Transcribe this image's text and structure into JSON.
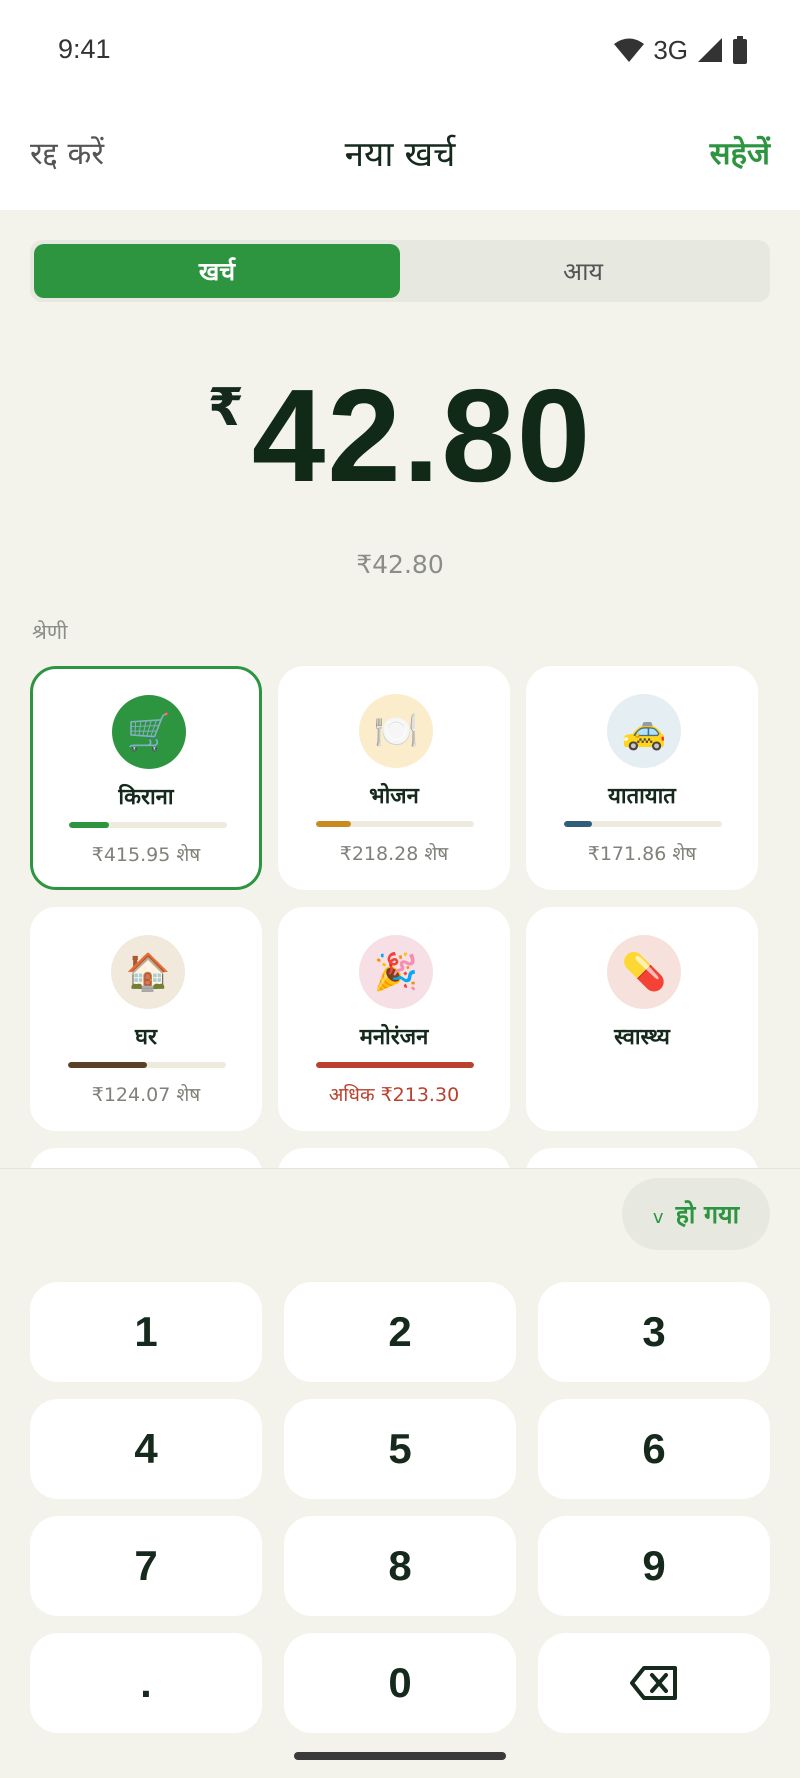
{
  "status_bar": {
    "time": "9:41",
    "network": "3G",
    "icons": [
      "wifi-icon",
      "cellular-signal-icon",
      "battery-icon"
    ]
  },
  "header": {
    "cancel_label": "रद्द करें",
    "title": "नया खर्च",
    "save_label": "सहेजें"
  },
  "type_toggle": {
    "expense_label": "खर्च",
    "income_label": "आय",
    "selected": "खर्च"
  },
  "amount": {
    "currency_symbol": "₹",
    "value": "42.80",
    "formatted": "₹42.80"
  },
  "category_section": {
    "label": "श्रेणी",
    "categories": [
      {
        "name": "किराना",
        "icon": "shopping-cart-icon",
        "glyph": "🛒",
        "remaining": "₹415.95 शेष",
        "progress": 0.25,
        "bar_color": "#2d9440",
        "icon_bg": "#2d9440",
        "selected": true
      },
      {
        "name": "भोजन",
        "icon": "plate-cutlery-icon",
        "glyph": "🍽️",
        "remaining": "₹218.28 शेष",
        "progress": 0.22,
        "bar_color": "#c98a1f",
        "icon_bg": "#fbeccb",
        "selected": false
      },
      {
        "name": "यातायात",
        "icon": "taxi-icon",
        "glyph": "🚕",
        "remaining": "₹171.86 शेष",
        "progress": 0.18,
        "bar_color": "#2f5d7a",
        "icon_bg": "#e4eef3",
        "selected": false
      },
      {
        "name": "घर",
        "icon": "house-icon",
        "glyph": "🏠",
        "remaining": "₹124.07 शेष",
        "progress": 0.5,
        "bar_color": "#5a4027",
        "icon_bg": "#f1e9dc",
        "selected": false
      },
      {
        "name": "मनोरंजन",
        "icon": "party-popper-icon",
        "glyph": "🎉",
        "remaining": "अधिक ₹213.30",
        "progress": 1.0,
        "bar_color": "#b9412e",
        "icon_bg": "#f6e0e6",
        "over": true,
        "selected": false
      },
      {
        "name": "स्वास्थ्य",
        "icon": "pill-icon",
        "glyph": "💊",
        "remaining": "",
        "progress": null,
        "bar_color": "",
        "icon_bg": "#f7e1dc",
        "selected": false
      }
    ]
  },
  "done_button": {
    "label": "हो गया",
    "chevron": "v"
  },
  "keypad": {
    "keys": [
      "1",
      "2",
      "3",
      "4",
      "5",
      "6",
      "7",
      "8",
      "9",
      ".",
      "0",
      "backspace"
    ]
  }
}
